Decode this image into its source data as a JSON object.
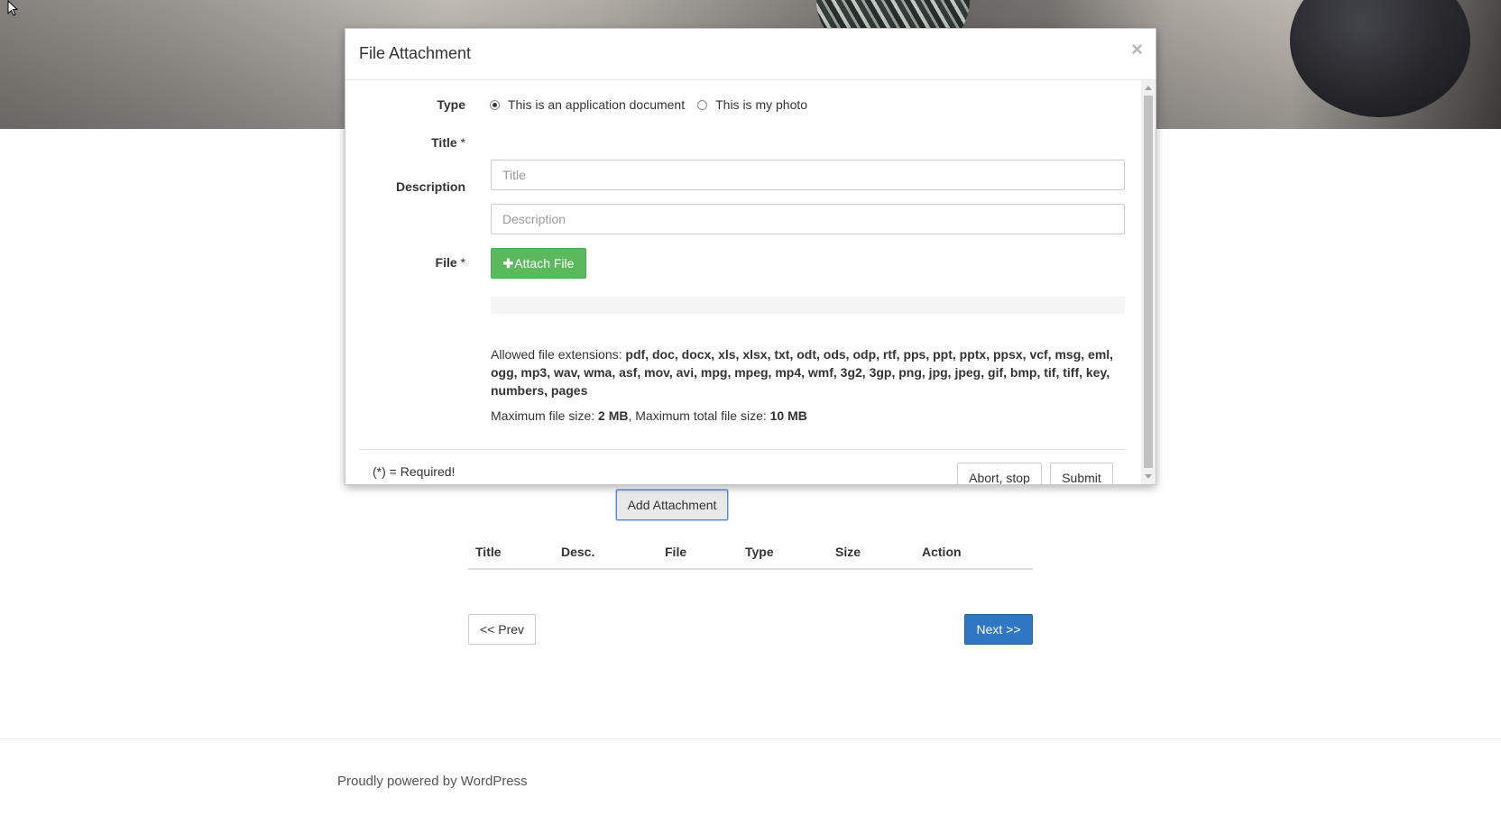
{
  "modal": {
    "title": "File Attachment",
    "close_symbol": "×",
    "type_label": "Type",
    "type_options": [
      {
        "label": "This is an application document",
        "checked": true
      },
      {
        "label": "This is my photo",
        "checked": false
      }
    ],
    "title_label": "Title",
    "title_placeholder": "Title",
    "description_label": "Description",
    "description_placeholder": "Description",
    "file_label": "File",
    "required_mark": "*",
    "attach_button": "Attach File",
    "attach_icon": "plus-icon",
    "allowed_prefix": "Allowed file extensions: ",
    "allowed_line1": "pdf, doc, docx, xls, xlsx, txt, odt, ods, odp, rtf, pps, ppt, pptx, ppsx, vcf, msg, eml,",
    "allowed_line2": "ogg, mp3, wav, wma, asf, mov, avi, mpg, mpeg, mp4, wmf, 3g2, 3gp, png, jpg, jpeg, gif, bmp, tif, tiff, key,",
    "allowed_line3": "numbers, pages",
    "max_size_prefix": "Maximum file size: ",
    "max_size": "2 MB",
    "max_total_prefix": ", Maximum total file size: ",
    "max_total": "10 MB",
    "required_note": "(*) = Required!",
    "abort_button": "Abort, stop",
    "submit_button": "Submit"
  },
  "page": {
    "add_attachment_button": "Add Attachment",
    "table_headers": [
      "Title",
      "Desc.",
      "File",
      "Type",
      "Size",
      "Action"
    ],
    "prev_button": "<< Prev",
    "next_button": "Next >>",
    "footer": "Proudly powered by WordPress"
  },
  "colors": {
    "success_green": "#5cb85c",
    "primary_blue": "#2f77c2"
  }
}
